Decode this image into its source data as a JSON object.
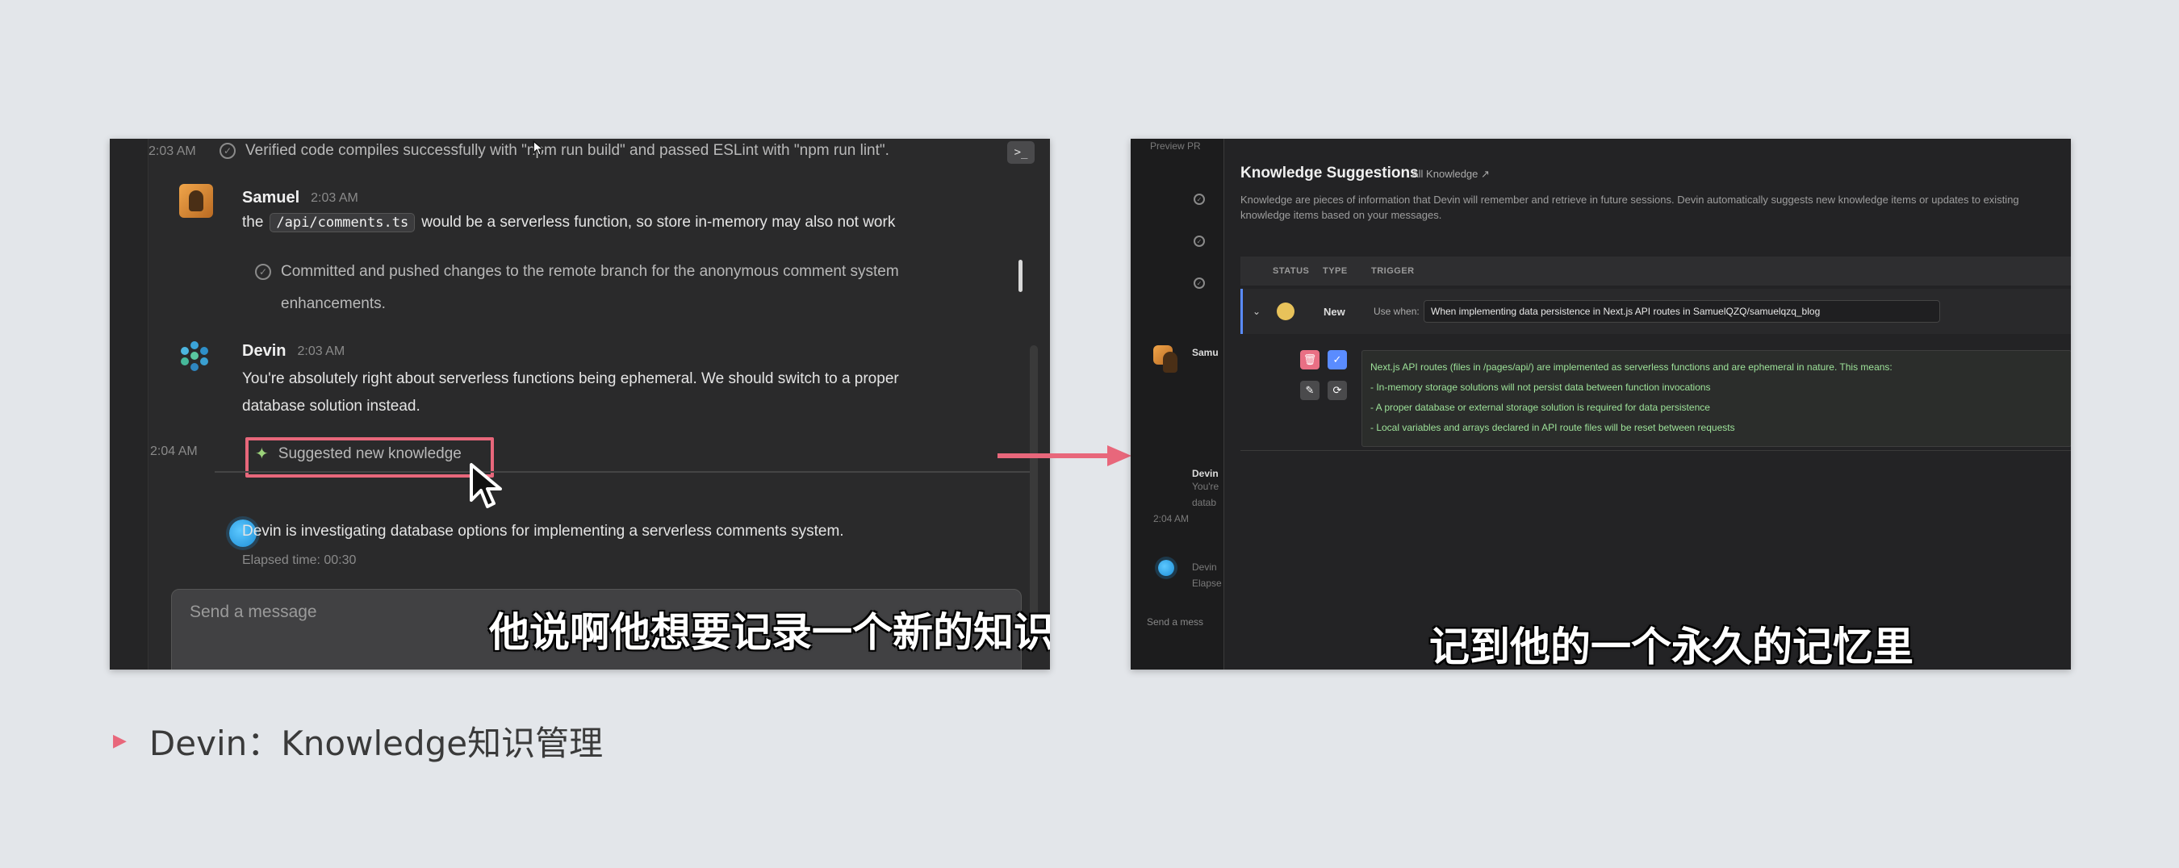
{
  "left": {
    "entries": [
      {
        "time": "2:03 AM",
        "text": "Verified code compiles successfully with \"npm run build\" and passed ESLint with \"npm run lint\"."
      }
    ],
    "samuel": {
      "name": "Samuel",
      "time": "2:03 AM",
      "text_before": "the",
      "code": "/api/comments.ts",
      "text_after": "would be a serverless function, so store in-memory may also not work"
    },
    "commit_entry": {
      "line1": "Committed and pushed changes to the remote branch for the anonymous comment system",
      "line2": "enhancements."
    },
    "devin": {
      "name": "Devin",
      "time": "2:03 AM",
      "line1": "You're absolutely right about serverless functions being ephemeral. We should switch to a proper",
      "line2": "database solution instead."
    },
    "suggested": {
      "time": "2:04 AM",
      "label": "Suggested new knowledge"
    },
    "status": {
      "text": "Devin is investigating database options for implementing a serverless comments system.",
      "elapsed": "Elapsed time: 00:30"
    },
    "input_placeholder": "Send a message",
    "subtitle": "他说啊他想要记录一个新的知识"
  },
  "right": {
    "bg": {
      "preview": "Preview PR",
      "samuel": "Samu",
      "devin": "Devin",
      "you": "You're",
      "datab": "datab",
      "time": "2:04 AM",
      "devin2": "Devin",
      "elapsed": "Elapse",
      "send": "Send a mess"
    },
    "modal": {
      "title": "Knowledge Suggestions",
      "link": "All Knowledge",
      "description": "Knowledge are pieces of information that Devin will remember and retrieve in future sessions. Devin automatically suggests new knowledge items or updates to existing knowledge items based on your messages.",
      "columns": [
        "STATUS",
        "TYPE",
        "TRIGGER"
      ],
      "row": {
        "type": "New",
        "use_when": "Use when:",
        "trigger": "When implementing data persistence in Next.js API routes in SamuelQZQ/samuelqzq_blog"
      },
      "knowledge_lines": [
        "Next.js API routes (files in /pages/api/) are implemented as serverless functions and are ephemeral in nature. This means:",
        "- In-memory storage solutions will not persist data between function invocations",
        "- A proper database or external storage solution is required for data persistence",
        "- Local variables and arrays declared in API route files will be reset between requests"
      ]
    },
    "subtitle": "记到他的一个永久的记忆里"
  },
  "caption": "Devin：Knowledge知识管理",
  "colors": {
    "accent": "#e8677b",
    "page_bg": "#e3e6ea",
    "knowledge_text": "#9ee39a"
  }
}
